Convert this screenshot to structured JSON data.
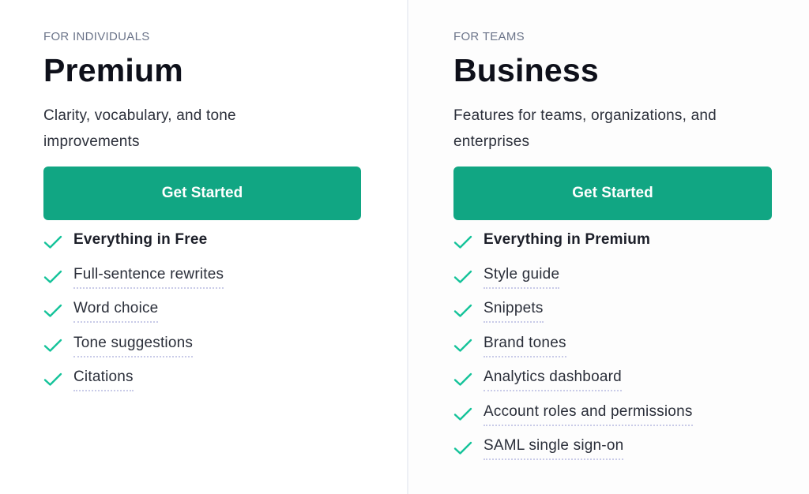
{
  "plans": [
    {
      "eyebrow": "FOR INDIVIDUALS",
      "title": "Premium",
      "description": "Clarity, vocabulary, and tone improvements",
      "cta_label": "Get Started",
      "features": [
        {
          "label": "Everything in Free",
          "bold": true
        },
        {
          "label": "Full-sentence rewrites",
          "bold": false
        },
        {
          "label": "Word choice",
          "bold": false
        },
        {
          "label": "Tone suggestions",
          "bold": false
        },
        {
          "label": "Citations",
          "bold": false
        }
      ]
    },
    {
      "eyebrow": "FOR TEAMS",
      "title": "Business",
      "description": "Features for teams, organizations, and enterprises",
      "cta_label": "Get Started",
      "features": [
        {
          "label": "Everything in Premium",
          "bold": true
        },
        {
          "label": "Style guide",
          "bold": false
        },
        {
          "label": "Snippets",
          "bold": false
        },
        {
          "label": "Brand tones",
          "bold": false
        },
        {
          "label": "Analytics dashboard",
          "bold": false
        },
        {
          "label": "Account roles and permissions",
          "bold": false
        },
        {
          "label": "SAML single sign-on",
          "bold": false
        }
      ]
    }
  ],
  "colors": {
    "accent": "#11a683",
    "check": "#15c39a",
    "eyebrow": "#6b7489",
    "title": "#0e101a"
  },
  "icons": {
    "feature_check": "check-icon"
  }
}
